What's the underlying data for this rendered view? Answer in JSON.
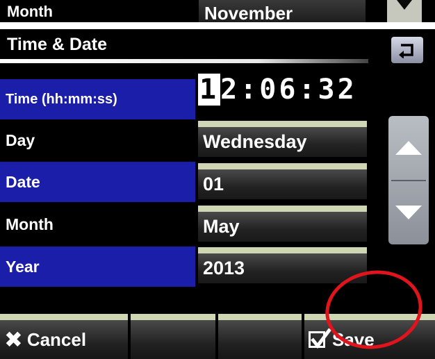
{
  "prev_screen": {
    "label": "Month",
    "value": "November"
  },
  "title": "Time & Date",
  "rows": [
    {
      "label": "Time (hh:mm:ss)",
      "value": ""
    },
    {
      "label": "Day",
      "value": "Wednesday"
    },
    {
      "label": "Date",
      "value": "01"
    },
    {
      "label": "Month",
      "value": "May"
    },
    {
      "label": "Year",
      "value": "2013"
    }
  ],
  "time": {
    "hour_tens": "1",
    "hour_units": "2",
    "minutes": "06",
    "seconds": "32",
    "separator": ":"
  },
  "buttons": {
    "cancel": "Cancel",
    "save": "Save"
  },
  "icons": {
    "back": "back-arrow-icon",
    "scroll_up": "triangle-up-icon",
    "scroll_down": "triangle-down-icon",
    "cancel": "x-icon",
    "save": "checkbox-check-icon"
  },
  "colors": {
    "highlight_row": "#1a1ea8",
    "screen_bg": "#000000",
    "annotation": "#e0141c"
  }
}
